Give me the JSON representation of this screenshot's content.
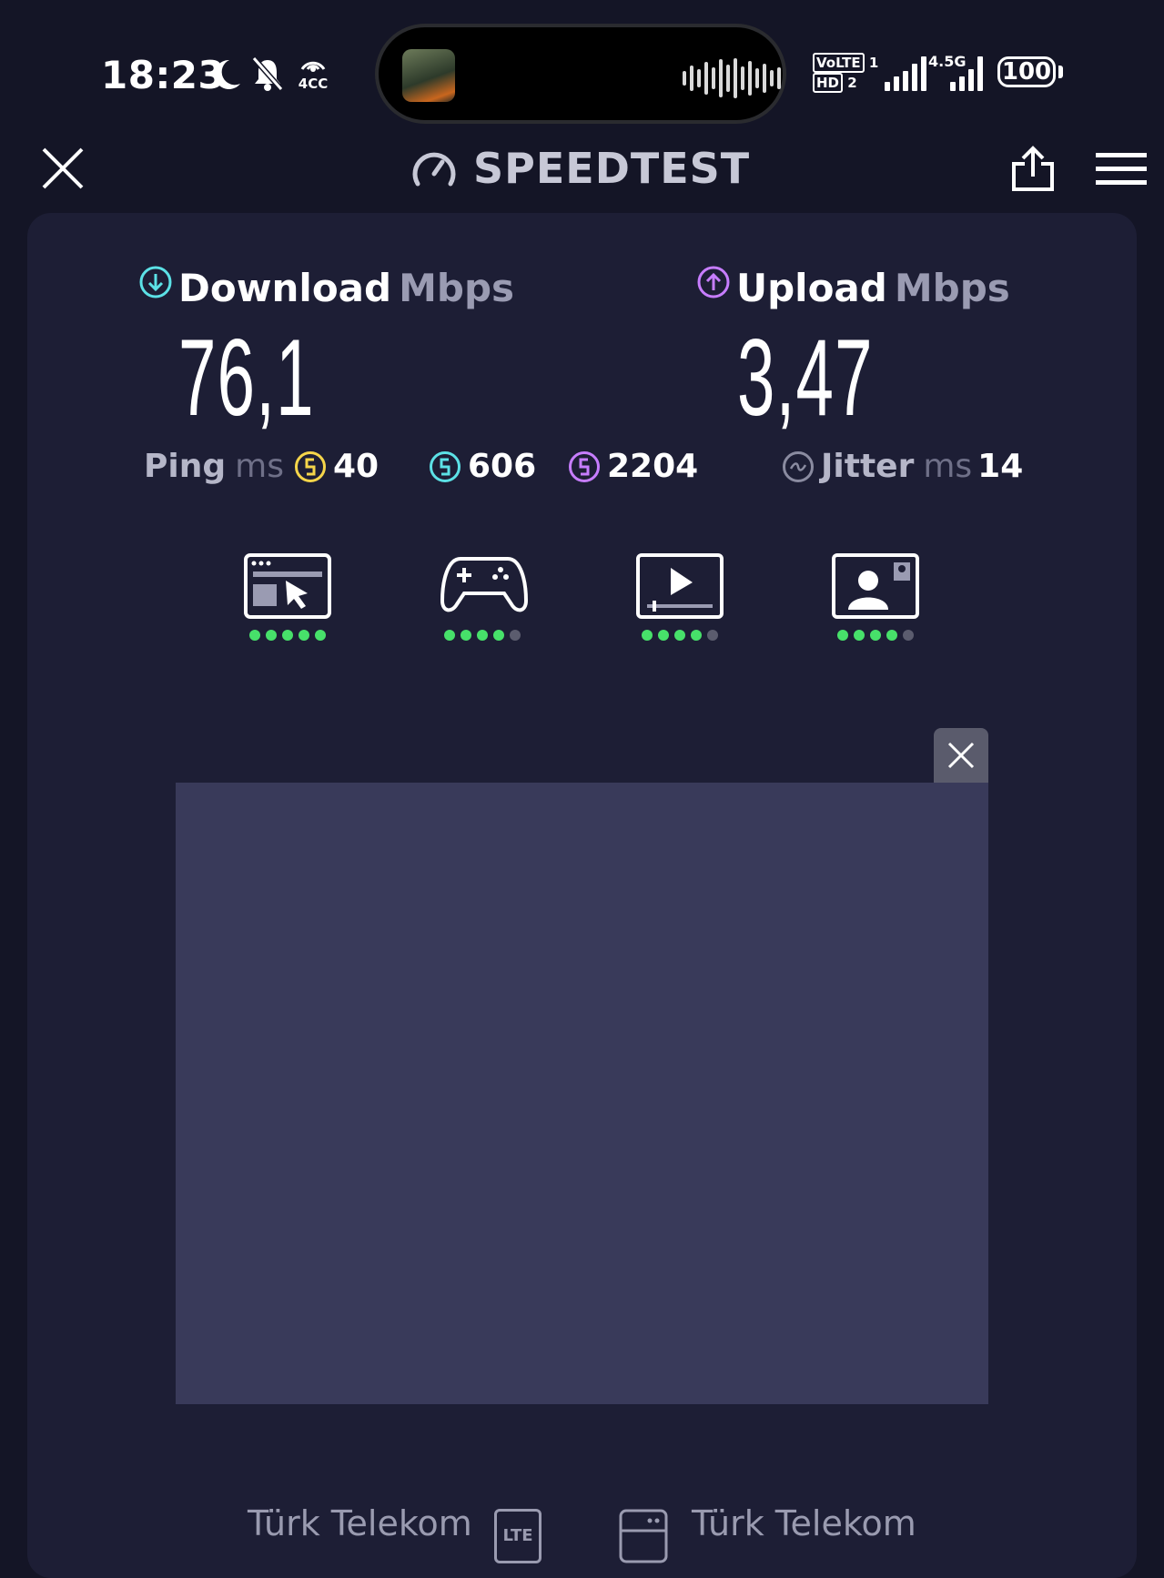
{
  "status_bar": {
    "time": "18:23",
    "cast_label": "4CC",
    "volte_label": "VoLTE",
    "sim1": "1",
    "hd_label": "HD",
    "sim2": "2",
    "network_label": "4.5G",
    "battery": "100"
  },
  "header": {
    "title": "SPEEDTEST",
    "close_icon": "close-icon",
    "share_icon": "share-icon",
    "menu_icon": "menu-icon"
  },
  "download": {
    "label": "Download",
    "unit": "Mbps",
    "value": "76,1",
    "color": "#5ce1e6"
  },
  "upload": {
    "label": "Upload",
    "unit": "Mbps",
    "value": "3,47",
    "color": "#c77dff"
  },
  "ping": {
    "label": "Ping",
    "unit": "ms",
    "idle": "40",
    "download": "606",
    "upload": "2204",
    "idle_color": "#f5d54a"
  },
  "jitter": {
    "label": "Jitter",
    "unit": "ms",
    "value": "14"
  },
  "use_cases": [
    {
      "name": "web-browsing-icon",
      "rating": 5,
      "max": 5
    },
    {
      "name": "gaming-icon",
      "rating": 4,
      "max": 5
    },
    {
      "name": "video-streaming-icon",
      "rating": 4,
      "max": 5
    },
    {
      "name": "video-call-icon",
      "rating": 4,
      "max": 5
    }
  ],
  "footer": {
    "provider": "Türk Telekom",
    "provider_tech": "LTE",
    "server": "Türk Telekom"
  }
}
